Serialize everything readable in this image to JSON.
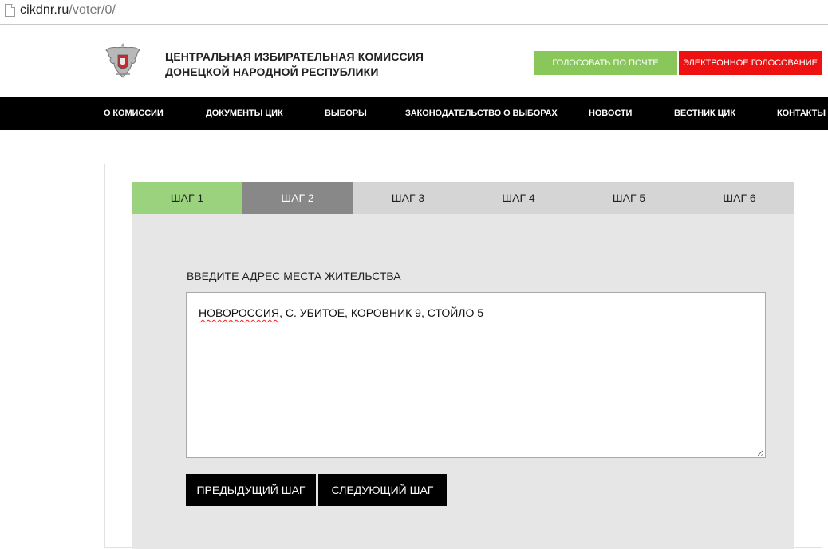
{
  "browser": {
    "url_host": "cikdnr.ru",
    "url_path": "/voter/0/"
  },
  "header": {
    "org_line1": "ЦЕНТРАЛЬНАЯ ИЗБИРАТЕЛЬНАЯ КОМИССИЯ",
    "org_line2": "ДОНЕЦКОЙ НАРОДНОЙ РЕСПУБЛИКИ",
    "btn_post_vote": "ГОЛОСОВАТЬ ПО ПОЧТЕ",
    "btn_e_vote": "ЭЛЕКТРОННОЕ ГОЛОСОВАНИЕ",
    "emblem_icon": "coat-of-arms-emblem"
  },
  "nav": {
    "items": [
      "О КОМИССИИ",
      "ДОКУМЕНТЫ ЦИК",
      "ВЫБОРЫ",
      "ЗАКОНОДАТЕЛЬСТВО О ВЫБОРАХ",
      "НОВОСТИ",
      "ВЕСТНИК ЦИК",
      "КОНТАКТЫ"
    ]
  },
  "wizard": {
    "tabs": [
      "ШАГ 1",
      "ШАГ 2",
      "ШАГ 3",
      "ШАГ 4",
      "ШАГ 5",
      "ШАГ 6"
    ],
    "completed_step": 1,
    "active_step": 2,
    "field_label": "ВВЕДИТЕ АДРЕС МЕСТА ЖИТЕЛЬСТВА",
    "address_misspelled": "НОВОРОССИЯ",
    "address_rest": ", С. УБИТОЕ, КОРОВНИК 9, СТОЙЛО 5",
    "btn_prev": "ПРЕДЫДУЩИЙ ШАГ",
    "btn_next": "СЛЕДУЮЩИЙ ШАГ"
  },
  "colors": {
    "done_tab": "#9bd27d",
    "active_tab": "#888888",
    "post_button": "#8ac75b",
    "evote_button": "#ee1111",
    "nav_bg": "#000000"
  }
}
